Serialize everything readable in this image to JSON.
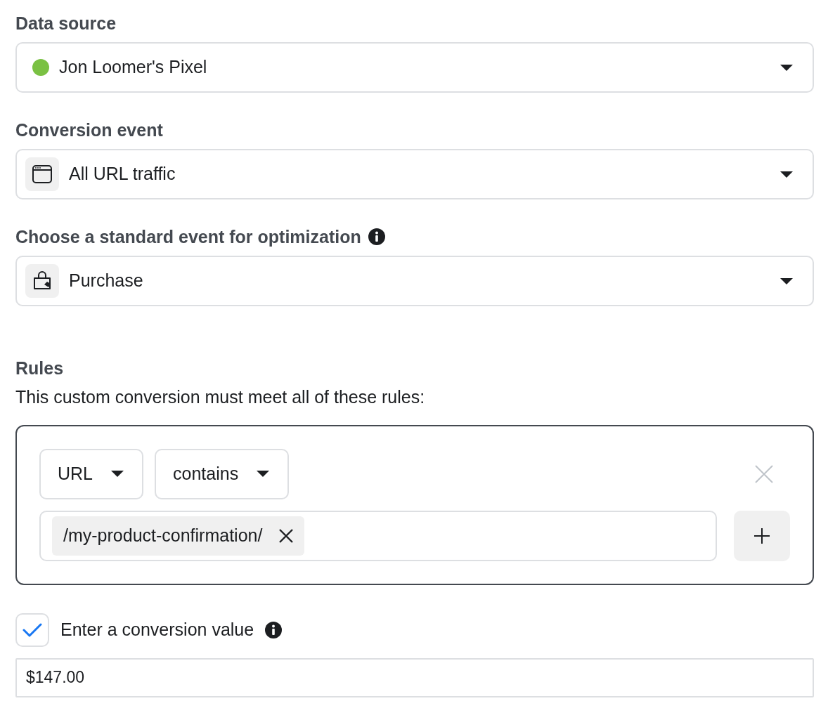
{
  "data_source": {
    "label": "Data source",
    "value": "Jon Loomer's Pixel",
    "color": "#7ac143"
  },
  "conversion_event": {
    "label": "Conversion event",
    "value": "All URL traffic"
  },
  "standard_event": {
    "label": "Choose a standard event for optimization",
    "value": "Purchase"
  },
  "rules": {
    "title": "Rules",
    "description": "This custom conversion must meet all of these rules:",
    "field": "URL",
    "operator": "contains",
    "values": [
      "/my-product-confirmation/"
    ]
  },
  "conversion_value": {
    "label": "Enter a conversion value",
    "checked": true,
    "value": "$147.00"
  }
}
